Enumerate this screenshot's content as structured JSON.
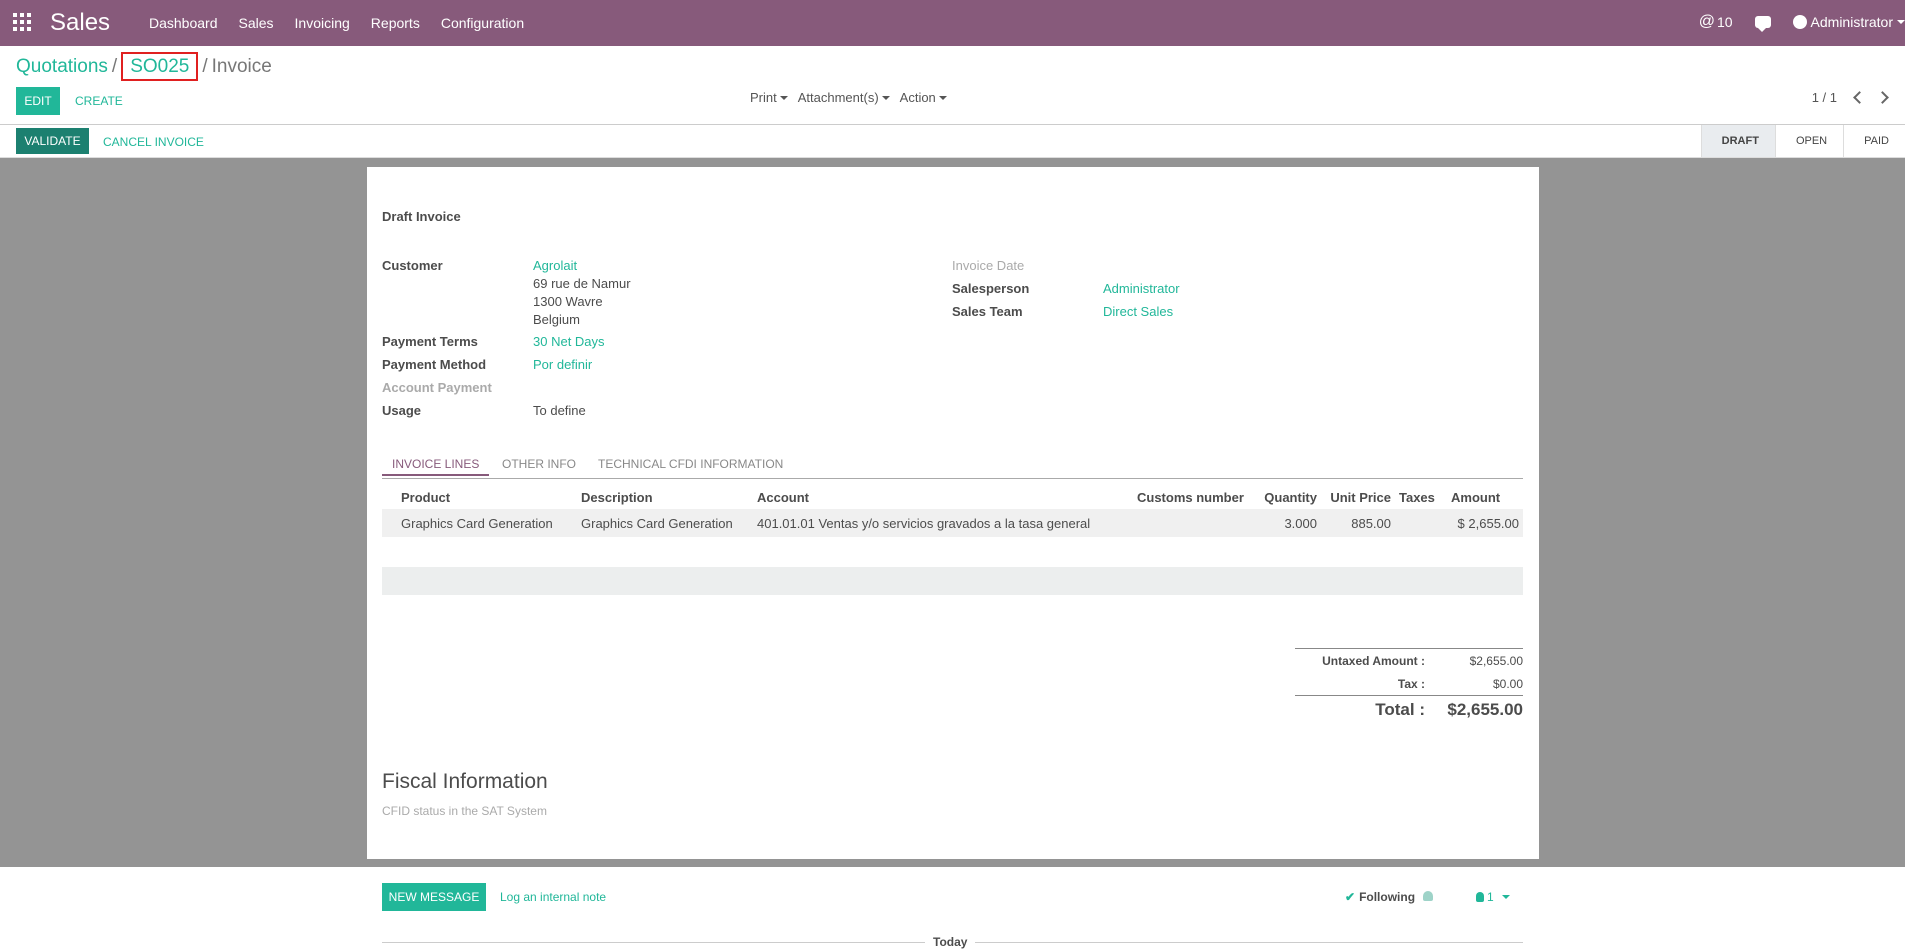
{
  "app": {
    "title": "Sales"
  },
  "menu": [
    "Dashboard",
    "Sales",
    "Invoicing",
    "Reports",
    "Configuration"
  ],
  "systray": {
    "mentions": "10",
    "user": "Administrator"
  },
  "breadcrumb": {
    "root": "Quotations",
    "order": "SO025",
    "current": "Invoice"
  },
  "buttons": {
    "edit": "EDIT",
    "create": "CREATE",
    "validate": "VALIDATE",
    "cancel_invoice": "CANCEL INVOICE"
  },
  "sidebar": {
    "print": "Print",
    "attachments": "Attachment(s)",
    "action": "Action"
  },
  "pager": "1 / 1",
  "states": [
    "DRAFT",
    "OPEN",
    "PAID"
  ],
  "active_state": "DRAFT",
  "invoice": {
    "heading": "Draft Invoice",
    "customer_label": "Customer",
    "customer_name": "Agrolait",
    "address_line1": "69 rue de Namur",
    "address_line2": "1300 Wavre",
    "address_line3": "Belgium",
    "payment_terms_label": "Payment Terms",
    "payment_terms": "30 Net Days",
    "payment_method_label": "Payment Method",
    "payment_method": "Por definir",
    "account_payment_label": "Account Payment",
    "usage_label": "Usage",
    "usage": "To define",
    "invoice_date_label": "Invoice Date",
    "salesperson_label": "Salesperson",
    "salesperson": "Administrator",
    "sales_team_label": "Sales Team",
    "sales_team": "Direct Sales"
  },
  "tabs": [
    "INVOICE LINES",
    "OTHER INFO",
    "TECHNICAL CFDI INFORMATION"
  ],
  "lines": {
    "headers": [
      "Product",
      "Description",
      "Account",
      "Customs number",
      "Quantity",
      "Unit Price",
      "Taxes",
      "Amount"
    ],
    "rows": [
      [
        "Graphics Card Generation",
        "Graphics Card Generation",
        "401.01.01 Ventas y/o servicios gravados a la tasa general",
        "",
        "3.000",
        "885.00",
        "",
        "$ 2,655.00"
      ]
    ]
  },
  "totals": {
    "untaxed_label": "Untaxed Amount :",
    "untaxed": "$2,655.00",
    "tax_label": "Tax :",
    "tax": "$0.00",
    "total_label": "Total :",
    "total": "$2,655.00"
  },
  "fiscal": {
    "title": "Fiscal Information",
    "cfdi_status_label": "CFID status in the SAT System"
  },
  "chatter": {
    "new_message": "NEW MESSAGE",
    "log_note": "Log an internal note",
    "following": "Following",
    "followers": "1",
    "today": "Today"
  }
}
